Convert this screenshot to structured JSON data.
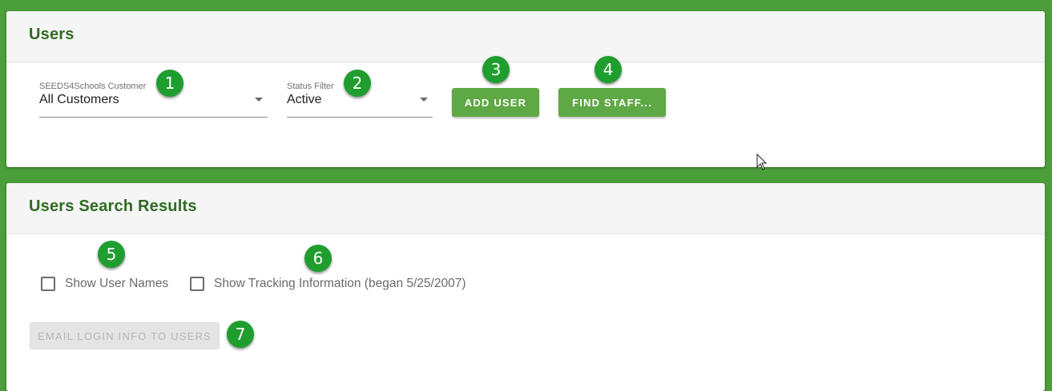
{
  "users_panel": {
    "title": "Users",
    "customer_select": {
      "label": "SEEDS4Schools Customer",
      "value": "All Customers"
    },
    "status_select": {
      "label": "Status Filter",
      "value": "Active"
    },
    "add_user_label": "ADD USER",
    "find_staff_label": "FIND STAFF..."
  },
  "results_panel": {
    "title": "Users Search Results",
    "show_user_names_label": "Show User Names",
    "show_tracking_label": "Show Tracking Information (began 5/25/2007)",
    "email_login_label": "EMAIL LOGIN INFO TO USERS"
  },
  "markers": [
    "1",
    "2",
    "3",
    "4",
    "5",
    "6",
    "7"
  ],
  "colors": {
    "background": "#4b9e3a",
    "title_green": "#2f6b22",
    "button_green": "#5ea845",
    "marker_green": "#1f9e2f"
  },
  "icons": {
    "select_caret": "caret-down-icon",
    "cursor": "mouse-pointer-icon"
  }
}
